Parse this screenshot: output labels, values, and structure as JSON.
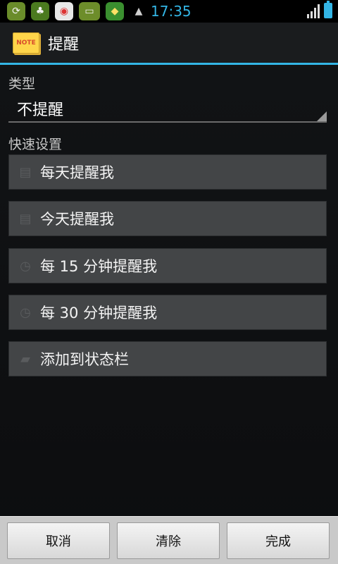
{
  "status_bar": {
    "time": "17:35",
    "icons": [
      "sync-app-icon",
      "game-app-icon",
      "chrome-app-icon",
      "battery-saver-app-icon",
      "green-app-icon",
      "android-icon"
    ],
    "accent_color": "#33b5e5"
  },
  "titlebar": {
    "app_icon_text": "NOTE",
    "title": "提醒"
  },
  "type_section": {
    "label": "类型",
    "selected_value": "不提醒"
  },
  "quick_section": {
    "label": "快速设置",
    "buttons": [
      {
        "label": "每天提醒我",
        "icon": "calendar-icon"
      },
      {
        "label": "今天提醒我",
        "icon": "calendar-icon"
      },
      {
        "label": "每 15 分钟提醒我",
        "icon": "clock-icon"
      },
      {
        "label": "每 30 分钟提醒我",
        "icon": "clock-icon"
      },
      {
        "label": "添加到状态栏",
        "icon": "statusbar-icon"
      }
    ]
  },
  "bottom_bar": {
    "cancel": "取消",
    "clear": "清除",
    "done": "完成"
  }
}
